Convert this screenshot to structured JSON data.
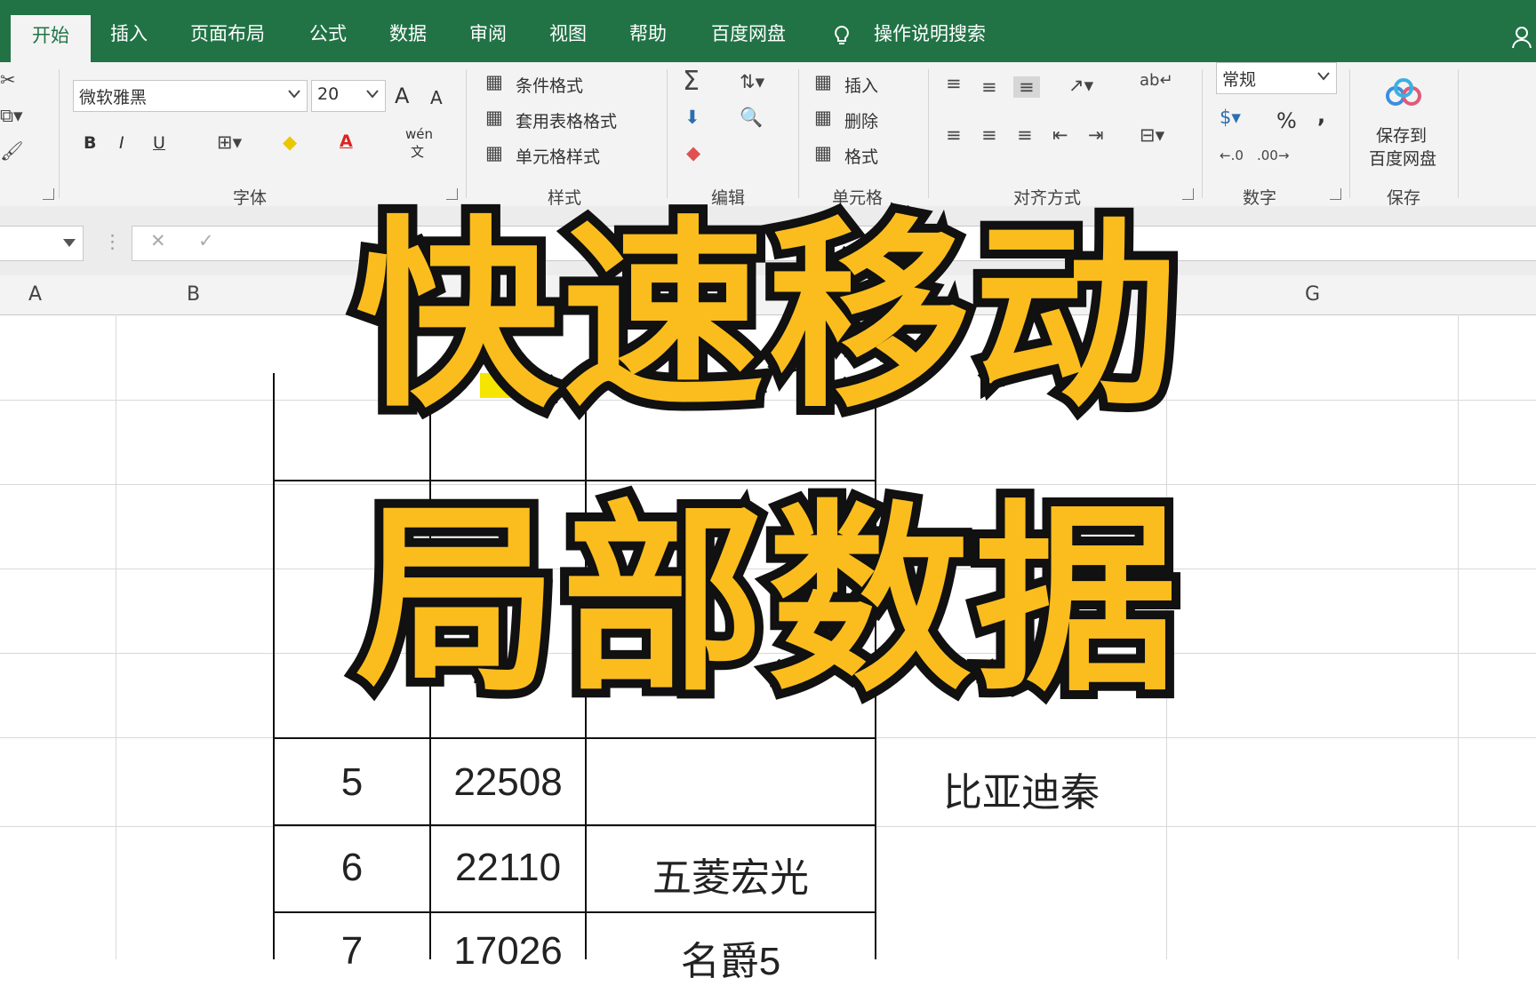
{
  "tabs": [
    "开始",
    "插入",
    "页面布局",
    "公式",
    "数据",
    "审阅",
    "视图",
    "帮助",
    "百度网盘"
  ],
  "tell_me": "操作说明搜索",
  "ribbon": {
    "font_name": "微软雅黑",
    "font_size": "20",
    "grow_font": "A",
    "shrink_font": "A",
    "bold": "B",
    "italic": "I",
    "underline": "U",
    "phonetic": "wén",
    "phonetic2": "文",
    "styles": [
      "条件格式",
      "套用表格格式",
      "单元格样式"
    ],
    "cells": [
      "插入",
      "删除",
      "格式"
    ],
    "number_format": "常规",
    "percent": "%",
    "comma": ",",
    "save_line1": "保存到",
    "save_line2": "百度网盘",
    "groups": {
      "font": "字体",
      "styles": "样式",
      "editing": "编辑",
      "cells": "单元格",
      "alignment": "对齐方式",
      "number": "数字",
      "save": "保存"
    }
  },
  "columns": [
    "A",
    "B",
    "G"
  ],
  "table": {
    "partial": [
      "0"
    ],
    "rows": [
      {
        "rank": "5",
        "sales": "22508",
        "model": "",
        "right": "比亚迪秦"
      },
      {
        "rank": "6",
        "sales": "22110",
        "model": "五菱宏光",
        "right": ""
      },
      {
        "rank": "7",
        "sales": "17026",
        "model": "名爵5",
        "right": ""
      }
    ]
  },
  "overlay": {
    "line1": "快速移动",
    "line2": "局部数据"
  },
  "colors": {
    "accent": "#217346",
    "overlay_fill": "#fbbd1e",
    "overlay_stroke": "#111111"
  }
}
